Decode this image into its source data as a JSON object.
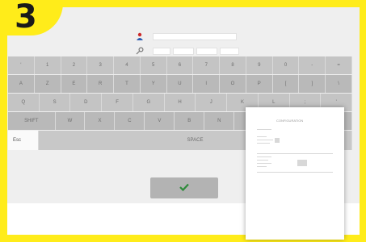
{
  "step_badge": "3",
  "keyboard": {
    "rows": [
      [
        "‘",
        "1",
        "2",
        "3",
        "4",
        "5",
        "6",
        "7",
        "8",
        "9",
        "0",
        "-",
        "="
      ],
      [
        "A",
        "Z",
        "E",
        "R",
        "T",
        "Y",
        "U",
        "I",
        "O",
        "P",
        "[",
        "]",
        "\\"
      ],
      [
        "Q",
        "S",
        "D",
        "F",
        "G",
        "H",
        "J",
        "K",
        "L",
        ";",
        "'"
      ],
      [
        "SHIFT",
        "W",
        "X",
        "C",
        "V",
        "B",
        "N",
        "?"
      ]
    ],
    "esc_label": "Esc",
    "space_label": "SPACE"
  },
  "document": {
    "title": "CONFIGURATION"
  },
  "colors": {
    "frame": "#ffec1a",
    "enter_icon": "#2e8b3a"
  },
  "icons": {
    "username": "user-icon",
    "password": "key-icon",
    "enter": "check-icon"
  }
}
